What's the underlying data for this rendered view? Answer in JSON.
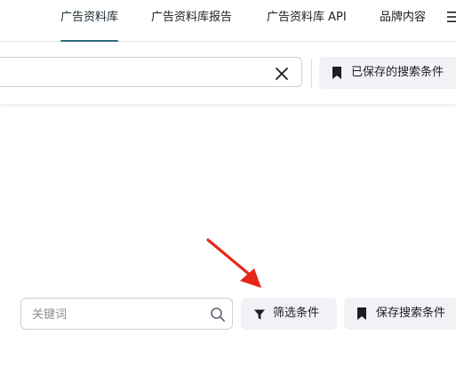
{
  "nav": {
    "tabs": [
      {
        "label": "广告资料库",
        "active": true
      },
      {
        "label": "广告资料库报告"
      },
      {
        "label": "广告资料库 API"
      },
      {
        "label": "品牌内容"
      }
    ],
    "menu_icon": "hamburger-menu-icon"
  },
  "search_bar": {
    "value": "",
    "clear_icon": "close-icon"
  },
  "saved_searches": {
    "label": "已保存的搜索条件",
    "icon": "bookmark-icon"
  },
  "keyword_search": {
    "placeholder": "关键词",
    "icon": "search-icon"
  },
  "filter_button": {
    "label": "筛选条件",
    "icon": "filter-funnel-icon"
  },
  "save_search_button": {
    "label": "保存搜索条件",
    "icon": "bookmark-icon"
  },
  "colors": {
    "accent_underline": "#2f6b7a",
    "button_bg": "#f0f2f5",
    "annotation_arrow": "#e8261a"
  }
}
